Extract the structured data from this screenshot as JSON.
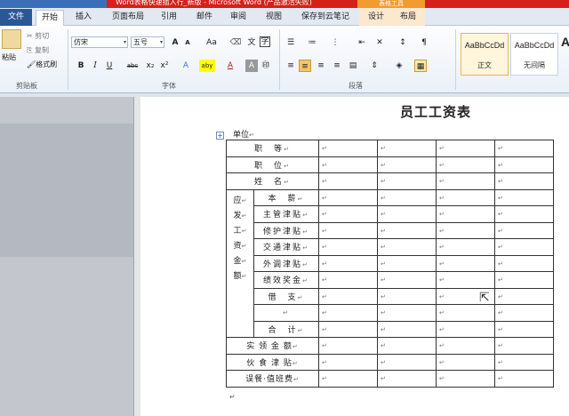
{
  "window": {
    "title": "Word表格快速插入行_新版 - Microsoft Word (产品激活失败)",
    "contextual_group": "表格工具"
  },
  "tabs": {
    "file": "文件",
    "items": [
      "开始",
      "插入",
      "页面布局",
      "引用",
      "邮件",
      "审阅",
      "视图",
      "保存到云笔记",
      "设计",
      "布局"
    ],
    "active": "开始"
  },
  "ribbon": {
    "clipboard": {
      "paste": "粘贴",
      "cut": "剪切",
      "copy": "复制",
      "format_painter": "格式刷",
      "group_label": "剪贴板"
    },
    "font": {
      "font_name": "仿宋",
      "font_size": "五号",
      "group_label": "字体",
      "grow": "A",
      "shrink": "A",
      "change_case": "Aa",
      "bold": "B",
      "italic": "I",
      "underline": "U",
      "strike": "abc",
      "sub": "x₂",
      "sup": "x²",
      "effects": "A",
      "highlight": "aby",
      "color": "A",
      "shade": "A",
      "pinyin": "文",
      "border_char": "A",
      "enclose": "字"
    },
    "paragraph": {
      "group_label": "段落"
    },
    "styles": {
      "items": [
        {
          "sample": "AaBbCcDd",
          "name": "正文"
        },
        {
          "sample": "AaBbCcDd",
          "name": "无间隔"
        },
        {
          "sample": "A",
          "name": ""
        }
      ]
    }
  },
  "document": {
    "title": "员工工资表",
    "unit_label": "单位",
    "para_mark": "↵",
    "rows": [
      {
        "label": "职　等"
      },
      {
        "label": "职　位"
      },
      {
        "label": "姓　名"
      },
      {
        "label": "本　薪"
      },
      {
        "label": "主管津贴"
      },
      {
        "label": "修护津贴"
      },
      {
        "label": "交通津贴"
      },
      {
        "label": "外调津贴"
      },
      {
        "label": "绩效奖金"
      },
      {
        "label": "借　支"
      },
      {
        "label": ""
      },
      {
        "label": "合　计"
      },
      {
        "label": "实 领 金 额"
      },
      {
        "label": "伙 食 津 贴"
      },
      {
        "label": "误餐·值班费"
      }
    ],
    "merged_label_chars": [
      "应",
      "发",
      "工",
      "资",
      "金",
      "额"
    ]
  }
}
